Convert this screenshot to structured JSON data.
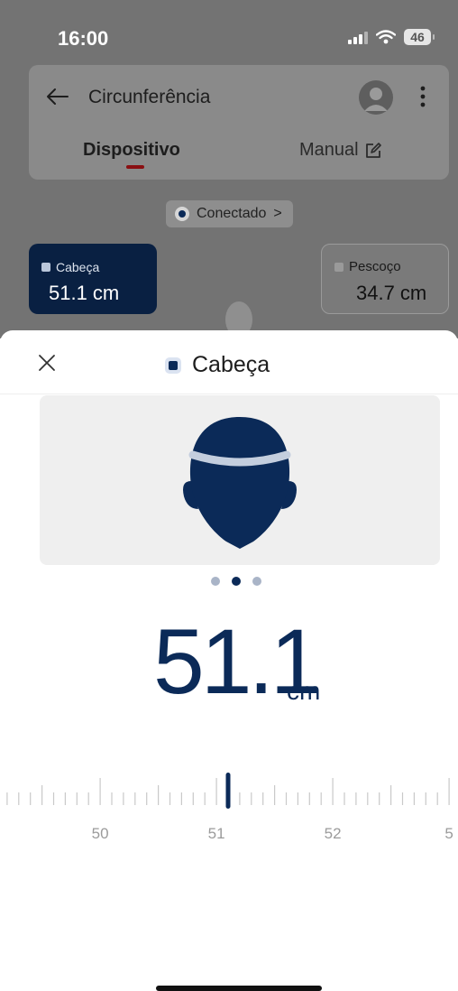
{
  "status_bar": {
    "time": "16:00",
    "battery": "46"
  },
  "app_bar": {
    "title": "Circunferência"
  },
  "tabs": {
    "device": "Dispositivo",
    "manual": "Manual"
  },
  "connection": {
    "label": "Conectado",
    "chevron": ">"
  },
  "measurements": {
    "head": {
      "label": "Cabeça",
      "value": "51.1 cm"
    },
    "neck": {
      "label": "Pescoço",
      "value": "34.7 cm"
    }
  },
  "sheet": {
    "title": "Cabeça",
    "value": "51.1",
    "unit": "cm",
    "carousel": {
      "count": 3,
      "active_index": 1
    },
    "ruler": {
      "labels": [
        "50",
        "51",
        "52",
        "5"
      ],
      "min": 49.1,
      "max": 53.0,
      "selected": 51.1
    }
  },
  "colors": {
    "primary": "#0b2a58",
    "accent_underline": "#8a0f12",
    "overlay": "#737373",
    "head_band": "#c4cede"
  },
  "icons": [
    "back-arrow-icon",
    "avatar-icon",
    "more-vertical-icon",
    "edit-icon",
    "close-icon",
    "head-illustration"
  ]
}
